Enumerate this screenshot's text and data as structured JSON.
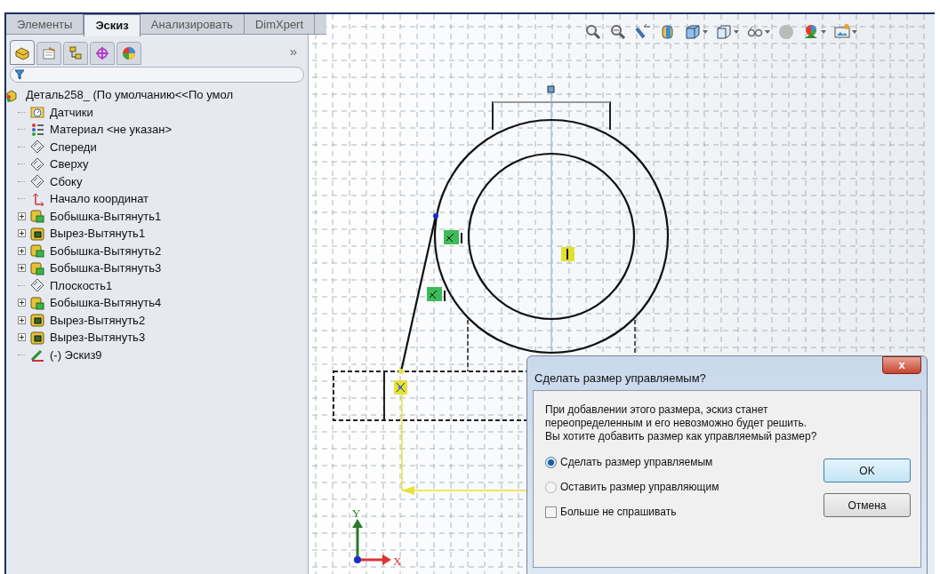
{
  "tabs": [
    {
      "label": "Элементы",
      "selected": false
    },
    {
      "label": "Эскиз",
      "selected": true
    },
    {
      "label": "Анализировать",
      "selected": false
    },
    {
      "label": "DimXpert",
      "selected": false
    }
  ],
  "manager_tabs": [
    {
      "kind": "feature",
      "selected": true
    },
    {
      "kind": "property",
      "selected": false
    },
    {
      "kind": "config",
      "selected": false
    },
    {
      "kind": "dimxpert",
      "selected": false
    },
    {
      "kind": "display",
      "selected": false
    }
  ],
  "more_glyph": "»",
  "tree": {
    "label": "Деталь258_  (По умолчанию<<По умол",
    "kind": "part",
    "children": [
      {
        "label": "Датчики",
        "kind": "sensor"
      },
      {
        "label": "Материал <не указан>",
        "kind": "material"
      },
      {
        "label": "Спереди",
        "kind": "plane"
      },
      {
        "label": "Сверху",
        "kind": "plane"
      },
      {
        "label": "Сбоку",
        "kind": "plane"
      },
      {
        "label": "Начало координат",
        "kind": "origin"
      },
      {
        "label": "Бобышка-Вытянуть1",
        "kind": "boss",
        "expanded": false
      },
      {
        "label": "Вырез-Вытянуть1",
        "kind": "cut",
        "expanded": false
      },
      {
        "label": "Бобышка-Вытянуть2",
        "kind": "boss",
        "expanded": false
      },
      {
        "label": "Бобышка-Вытянуть3",
        "kind": "boss",
        "expanded": false
      },
      {
        "label": "Плоскость1",
        "kind": "plane"
      },
      {
        "label": "Бобышка-Вытянуть4",
        "kind": "boss",
        "expanded": false
      },
      {
        "label": "Вырез-Вытянуть2",
        "kind": "cut",
        "expanded": false
      },
      {
        "label": "Вырез-Вытянуть3",
        "kind": "cut",
        "expanded": false
      },
      {
        "label": "(-) Эскиз9",
        "kind": "sketch"
      }
    ]
  },
  "axes": {
    "x": "X",
    "y": "Y"
  },
  "dialog": {
    "title": "Сделать размер управляемым?",
    "close": "x",
    "message": "При добавлении этого размера, эскиз станет переопределенным и его невозможно будет решить. Вы хотите добавить размер как управляемый размер?",
    "options": [
      {
        "label": "Сделать размер управляемым",
        "selected": true
      },
      {
        "label": "Оставить размер управляющим",
        "selected": false
      }
    ],
    "dont_ask": {
      "label": "Больше не спрашивать",
      "checked": false
    },
    "buttons": [
      {
        "label": "OK",
        "default": true
      },
      {
        "label": "Отмена",
        "default": false
      }
    ]
  }
}
